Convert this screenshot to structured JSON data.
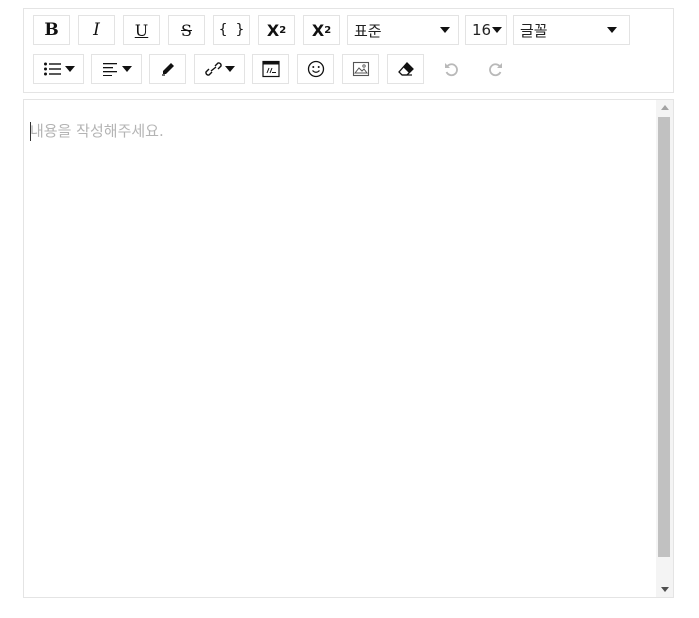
{
  "toolbar": {
    "row1": {
      "bold_label": "B",
      "italic_label": "I",
      "underline_label": "U",
      "strike_label": "S",
      "code_label": "{ }",
      "superscript_label": "X",
      "superscript_mark": "2",
      "subscript_label": "X",
      "subscript_mark": "2",
      "paragraph_select": "표준",
      "size_select": "16",
      "font_select": "글꼴"
    },
    "row2": {
      "icons": [
        "list-icon",
        "align-icon",
        "pen-icon",
        "link-icon",
        "table-icon",
        "emoji-icon",
        "image-icon",
        "eraser-icon",
        "undo-icon",
        "redo-icon"
      ]
    }
  },
  "editor": {
    "placeholder": "내용을 작성해주세요."
  },
  "colors": {
    "border": "#e4e4e4",
    "placeholder": "#b4b4b4",
    "disabled_icon": "#b9b9b9",
    "scroll_thumb": "#c1c1c1"
  }
}
